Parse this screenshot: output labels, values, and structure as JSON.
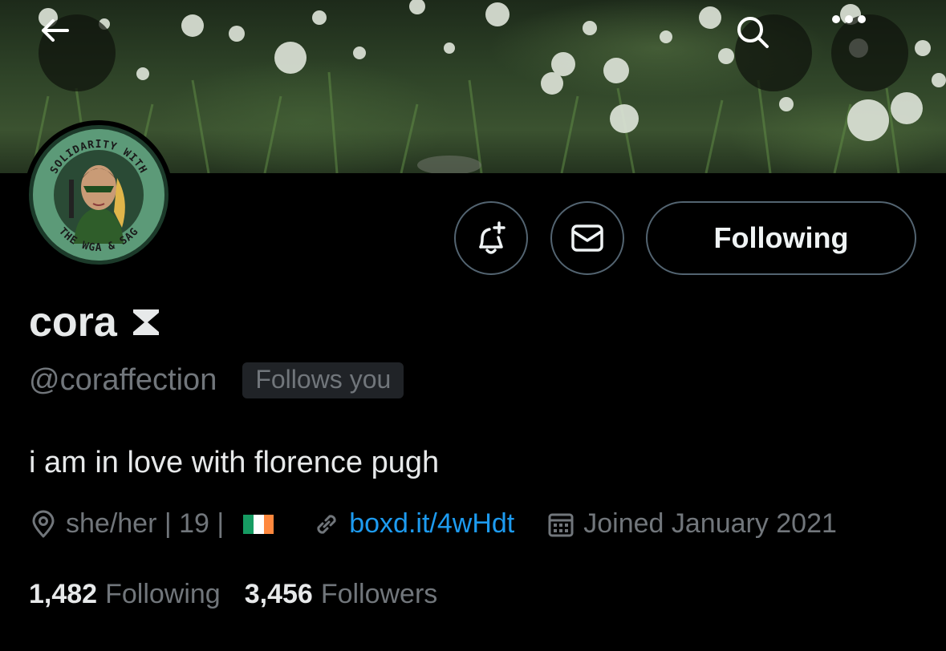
{
  "header": {
    "back_icon": "arrow-left-icon",
    "search_icon": "search-icon",
    "more_icon": "more-horizontal-icon"
  },
  "avatar": {
    "badge_top_text": "SOLIDARITY WITH",
    "badge_bottom_text": "THE WGA & SAG",
    "ring_color": "#5c9a78"
  },
  "actions": {
    "notify_icon": "bell-plus-icon",
    "message_icon": "envelope-icon",
    "following_label": "Following"
  },
  "profile": {
    "display_name": "cora",
    "name_icon": "hourglass-icon",
    "handle": "@coraffection",
    "follows_you": "Follows you",
    "bio": "i am in love with florence pugh"
  },
  "meta": {
    "location": "she/her | 19 |",
    "location_icon": "location-pin-icon",
    "flag_colors": [
      "#169b62",
      "#ffffff",
      "#ff883e"
    ],
    "link": "boxd.it/4wHdt",
    "link_icon": "link-icon",
    "link_color": "#1d9bf0",
    "joined": "Joined January 2021",
    "joined_icon": "calendar-icon"
  },
  "stats": {
    "following_count": "1,482",
    "following_label": "Following",
    "followers_count": "3,456",
    "followers_label": "Followers"
  }
}
